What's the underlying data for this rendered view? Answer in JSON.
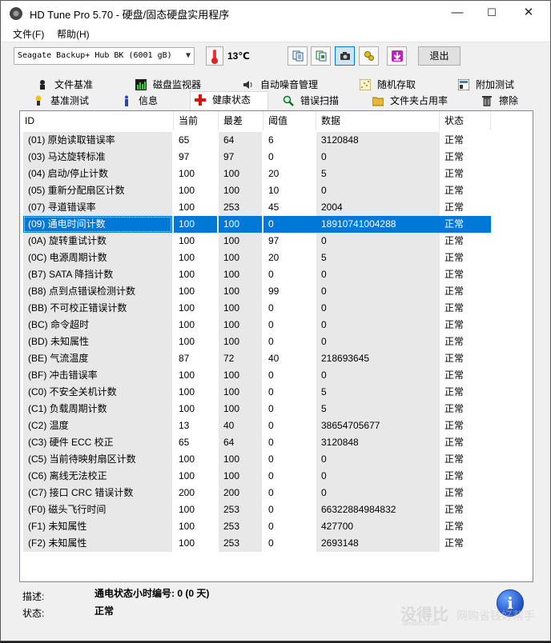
{
  "window": {
    "title": "HD Tune Pro 5.70 - 硬盘/固态硬盘实用程序",
    "minimize_glyph": "—",
    "maximize_glyph": "☐",
    "close_glyph": "✕"
  },
  "menu": [
    "文件(F)",
    "帮助(H)"
  ],
  "toolbar": {
    "drive": "Seagate Backup+ Hub BK (6001 gB)",
    "temperature": "13℃",
    "exit_label": "退出",
    "buttons": [
      "copy-text-icon",
      "copy-all-icon",
      "screenshot-icon",
      "options-icon",
      "save-icon"
    ]
  },
  "tabs_row1": [
    {
      "label": "文件基准",
      "icon": "file-benchmark-icon"
    },
    {
      "label": "磁盘监视器",
      "icon": "disk-monitor-icon"
    },
    {
      "label": "自动噪音管理",
      "icon": "speaker-icon"
    },
    {
      "label": "随机存取",
      "icon": "random-access-icon"
    },
    {
      "label": "附加测试",
      "icon": "extra-tests-icon"
    }
  ],
  "tabs_row2": [
    {
      "label": "基准测试",
      "icon": "benchmark-icon"
    },
    {
      "label": "信息",
      "icon": "info-icon"
    },
    {
      "label": "健康状态",
      "icon": "health-icon",
      "selected": true
    },
    {
      "label": "错误扫描",
      "icon": "error-scan-icon"
    },
    {
      "label": "文件夹占用率",
      "icon": "folder-icon"
    },
    {
      "label": "擦除",
      "icon": "erase-icon"
    }
  ],
  "table": {
    "columns": [
      "ID",
      "当前",
      "最差",
      "阈值",
      "数据",
      "状态"
    ],
    "rows": [
      [
        "(01) 原始读取错误率",
        "65",
        "64",
        "6",
        "3120848",
        "正常"
      ],
      [
        "(03) 马达旋转标准",
        "97",
        "97",
        "0",
        "0",
        "正常"
      ],
      [
        "(04) 启动/停止计数",
        "100",
        "100",
        "20",
        "5",
        "正常"
      ],
      [
        "(05) 重新分配扇区计数",
        "100",
        "100",
        "10",
        "0",
        "正常"
      ],
      [
        "(07) 寻道错误率",
        "100",
        "253",
        "45",
        "2004",
        "正常"
      ],
      [
        "(09) 通电时间计数",
        "100",
        "100",
        "0",
        "18910741004288",
        "正常"
      ],
      [
        "(0A) 旋转重试计数",
        "100",
        "100",
        "97",
        "0",
        "正常"
      ],
      [
        "(0C) 电源周期计数",
        "100",
        "100",
        "20",
        "5",
        "正常"
      ],
      [
        "(B7) SATA 降挡计数",
        "100",
        "100",
        "0",
        "0",
        "正常"
      ],
      [
        "(B8) 点到点错误检测计数",
        "100",
        "100",
        "99",
        "0",
        "正常"
      ],
      [
        "(BB) 不可校正错误计数",
        "100",
        "100",
        "0",
        "0",
        "正常"
      ],
      [
        "(BC) 命令超时",
        "100",
        "100",
        "0",
        "0",
        "正常"
      ],
      [
        "(BD) 未知属性",
        "100",
        "100",
        "0",
        "0",
        "正常"
      ],
      [
        "(BE) 气流温度",
        "87",
        "72",
        "40",
        "218693645",
        "正常"
      ],
      [
        "(BF) 冲击错误率",
        "100",
        "100",
        "0",
        "0",
        "正常"
      ],
      [
        "(C0) 不安全关机计数",
        "100",
        "100",
        "0",
        "5",
        "正常"
      ],
      [
        "(C1) 负载周期计数",
        "100",
        "100",
        "0",
        "5",
        "正常"
      ],
      [
        "(C2) 温度",
        "13",
        "40",
        "0",
        "38654705677",
        "正常"
      ],
      [
        "(C3) 硬件 ECC 校正",
        "65",
        "64",
        "0",
        "3120848",
        "正常"
      ],
      [
        "(C5) 当前待映射扇区计数",
        "100",
        "100",
        "0",
        "0",
        "正常"
      ],
      [
        "(C6) 离线无法校正",
        "100",
        "100",
        "0",
        "0",
        "正常"
      ],
      [
        "(C7) 接口 CRC 错误计数",
        "200",
        "200",
        "0",
        "0",
        "正常"
      ],
      [
        "(F0) 磁头飞行时间",
        "100",
        "253",
        "0",
        "66322884984832",
        "正常"
      ],
      [
        "(F1) 未知属性",
        "100",
        "253",
        "0",
        "427700",
        "正常"
      ],
      [
        "(F2) 未知属性",
        "100",
        "253",
        "0",
        "2693148",
        "正常"
      ]
    ],
    "selected_row": 5
  },
  "footer": {
    "desc_label": "描述:",
    "desc_value": "通电状态小时编号: 0 (0 天)",
    "status_label": "状态:",
    "status_value": "正常"
  },
  "watermark": {
    "brand": "没得比",
    "site": "Meidebi.com",
    "slogan": "网购省钱好帮手"
  },
  "colors": {
    "selection": "#0078d7",
    "alt_column": "#e8e8e8"
  }
}
